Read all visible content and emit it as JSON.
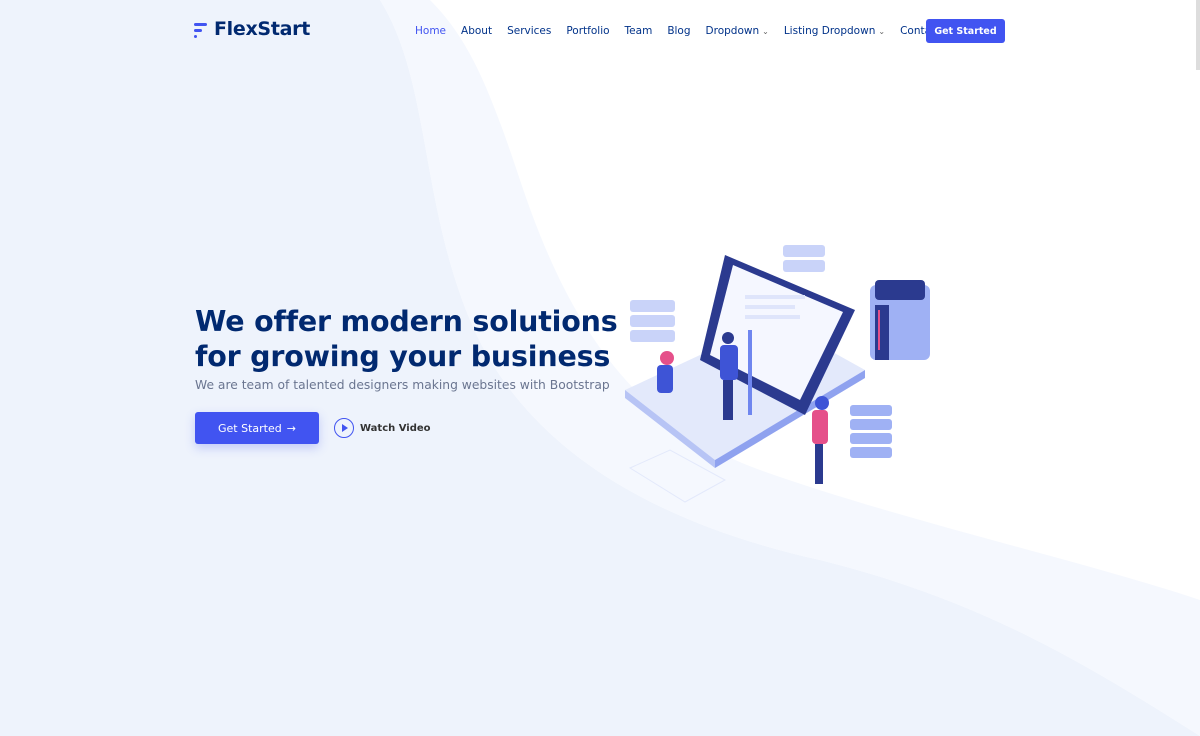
{
  "header": {
    "logo": "FlexStart",
    "nav": [
      {
        "label": "Home",
        "active": true
      },
      {
        "label": "About"
      },
      {
        "label": "Services"
      },
      {
        "label": "Portfolio"
      },
      {
        "label": "Team"
      },
      {
        "label": "Blog"
      },
      {
        "label": "Dropdown",
        "dropdown": true
      },
      {
        "label": "Listing Dropdown",
        "dropdown": true
      },
      {
        "label": "Contact"
      }
    ],
    "cta": "Get Started"
  },
  "hero": {
    "title_line1": "We offer modern solutions",
    "title_line2": "for growing your business",
    "subtitle": "We are team of talented designers making websites with Bootstrap",
    "primary_button": "Get Started",
    "primary_icon": "arrow-right-icon",
    "video_button": "Watch Video",
    "video_icon": "play-circle-icon"
  },
  "colors": {
    "accent": "#4154f1",
    "heading": "#012970",
    "background": "#eef3fc"
  }
}
